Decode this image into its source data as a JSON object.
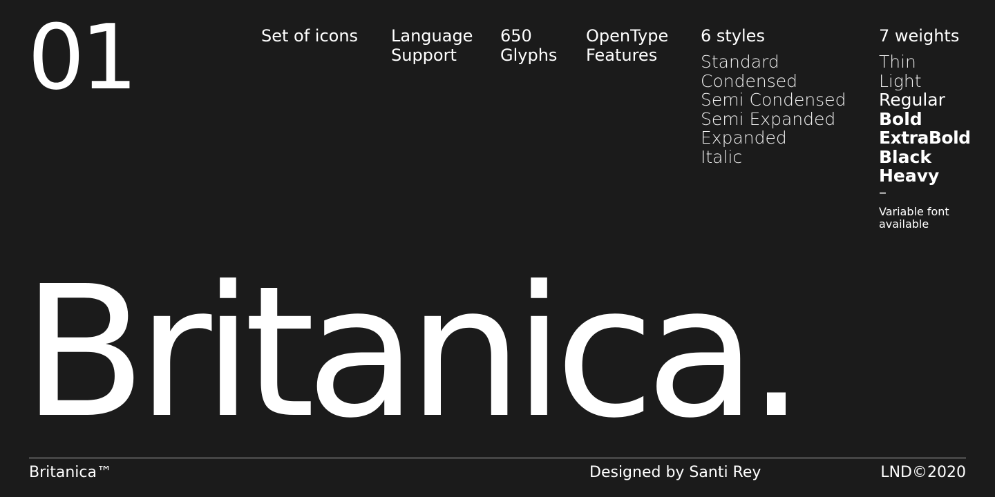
{
  "number": "01",
  "features": {
    "icons": "Set of icons",
    "language": "Language\nSupport",
    "glyphs": "650\nGlyphs",
    "opentype": "OpenType\nFeatures"
  },
  "styles": {
    "heading": "6 styles",
    "items": [
      "Standard",
      "Condensed",
      "Semi Condensed",
      "Semi Expanded",
      "Expanded",
      "Italic"
    ]
  },
  "weights": {
    "heading": "7 weights",
    "items": [
      "Thin",
      "Light",
      "Regular",
      "Bold",
      "ExtraBold",
      "Black",
      "Heavy"
    ],
    "dash": "–",
    "variable_note": "Variable font\navailable"
  },
  "hero": "Britanica.",
  "footer": {
    "brand": "Britanica™",
    "designer": "Designed by Santi Rey",
    "copyright": "LND©2020"
  },
  "colors": {
    "background": "#1b1b1b",
    "text": "#ffffff",
    "rule": "#b5b5b5"
  }
}
